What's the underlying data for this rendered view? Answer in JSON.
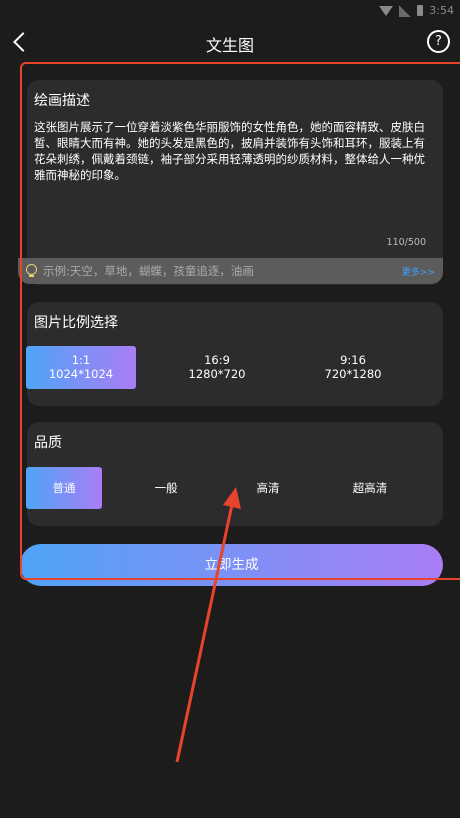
{
  "status": {
    "time": "3:54"
  },
  "header": {
    "title": "文生图",
    "help_icon": "?"
  },
  "description": {
    "label": "绘画描述",
    "text": "这张图片展示了一位穿着淡紫色华丽服饰的女性角色，她的面容精致、皮肤白皙、眼睛大而有神。她的头发是黑色的，披肩并装饰有头饰和耳环，服装上有花朵刺绣，佩戴着颈链，袖子部分采用轻薄透明的纱质材料，整体给人一种优雅而神秘的印象。",
    "counter": "110/500",
    "tip": "示例:天空，草地，蝴蝶，孩童追逐，油画",
    "more": "更多>>"
  },
  "ratio": {
    "label": "图片比例选择",
    "options": [
      {
        "ratio": "1:1",
        "size": "1024*1024",
        "selected": true
      },
      {
        "ratio": "16:9",
        "size": "1280*720",
        "selected": false
      },
      {
        "ratio": "9:16",
        "size": "720*1280",
        "selected": false
      }
    ]
  },
  "quality": {
    "label": "品质",
    "options": [
      "普通",
      "一般",
      "高清",
      "超高清"
    ],
    "selected": "普通"
  },
  "generate_button": "立即生成",
  "colors": {
    "accent_start": "#4fa4f7",
    "accent_end": "#a97df5",
    "annotation_red": "#e8442b",
    "more_link": "#3fa3ff"
  }
}
